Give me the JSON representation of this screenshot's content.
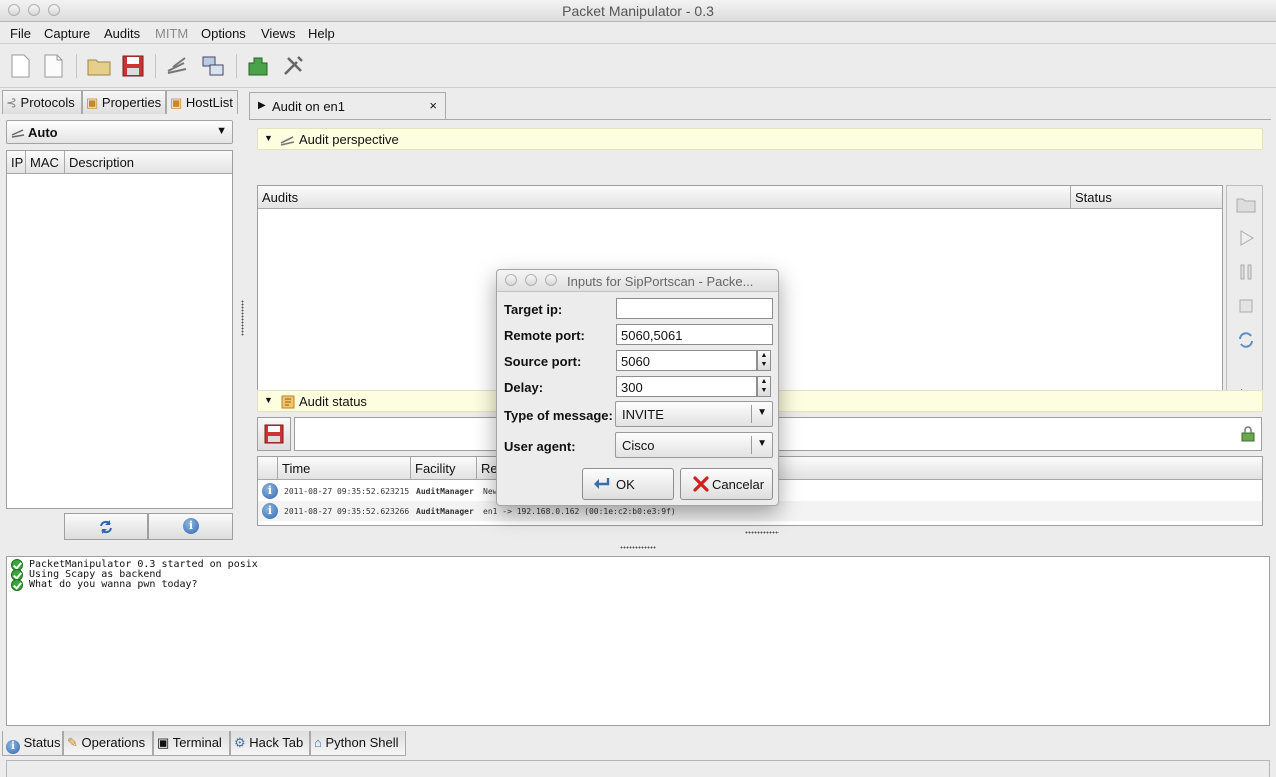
{
  "window": {
    "title": "Packet Manipulator - 0.3"
  },
  "menu": {
    "file": "File",
    "capture": "Capture",
    "audits": "Audits",
    "mitm": "MITM",
    "options": "Options",
    "views": "Views",
    "help": "Help"
  },
  "left_tabs": {
    "protocols": "Protocols",
    "properties": "Properties",
    "hostlist": "HostList"
  },
  "hostlist": {
    "interface": "Auto",
    "columns": {
      "ip": "IP",
      "mac": "MAC",
      "description": "Description"
    }
  },
  "audit_tab": {
    "label": "Audit on en1",
    "close": "×"
  },
  "audit_perspective": {
    "title": "Audit perspective",
    "columns": {
      "audits": "Audits",
      "status": "Status"
    }
  },
  "audit_status": {
    "title": "Audit status",
    "columns": {
      "time": "Time",
      "facility": "Facility",
      "reference": "Re"
    },
    "rows": [
      {
        "time": "2011-08-27 09:35:52.623215",
        "facility": "AuditManager",
        "message": "New"
      },
      {
        "time": "2011-08-27 09:35:52.623266",
        "facility": "AuditManager",
        "message": "en1 -> 192.168.0.162 (00:1e:c2:b0:e3:9f)"
      }
    ]
  },
  "console": {
    "lines": [
      "PacketManipulator 0.3 started on posix",
      "Using Scapy as backend",
      "What do you wanna pwn today?"
    ]
  },
  "bottom_tabs": {
    "status": "Status",
    "operations": "Operations",
    "terminal": "Terminal",
    "hack_tab": "Hack Tab",
    "python_shell": "Python Shell"
  },
  "dialog": {
    "title": "Inputs for SipPortscan - Packe...",
    "target_ip": {
      "label": "Target ip:",
      "value": ""
    },
    "remote_port": {
      "label": "Remote port:",
      "value": "5060,5061"
    },
    "source_port": {
      "label": "Source port:",
      "value": "5060"
    },
    "delay": {
      "label": "Delay:",
      "value": "300"
    },
    "message_type": {
      "label": "Type of message:",
      "value": "INVITE"
    },
    "user_agent": {
      "label": "User agent:",
      "value": "Cisco"
    },
    "ok": "OK",
    "cancel": "Cancelar"
  },
  "colors": {
    "section_bg": "#fdfde0",
    "console_ok": "#3aa53a",
    "info_blue": "#2f68b0",
    "cancel_red": "#d02020"
  }
}
